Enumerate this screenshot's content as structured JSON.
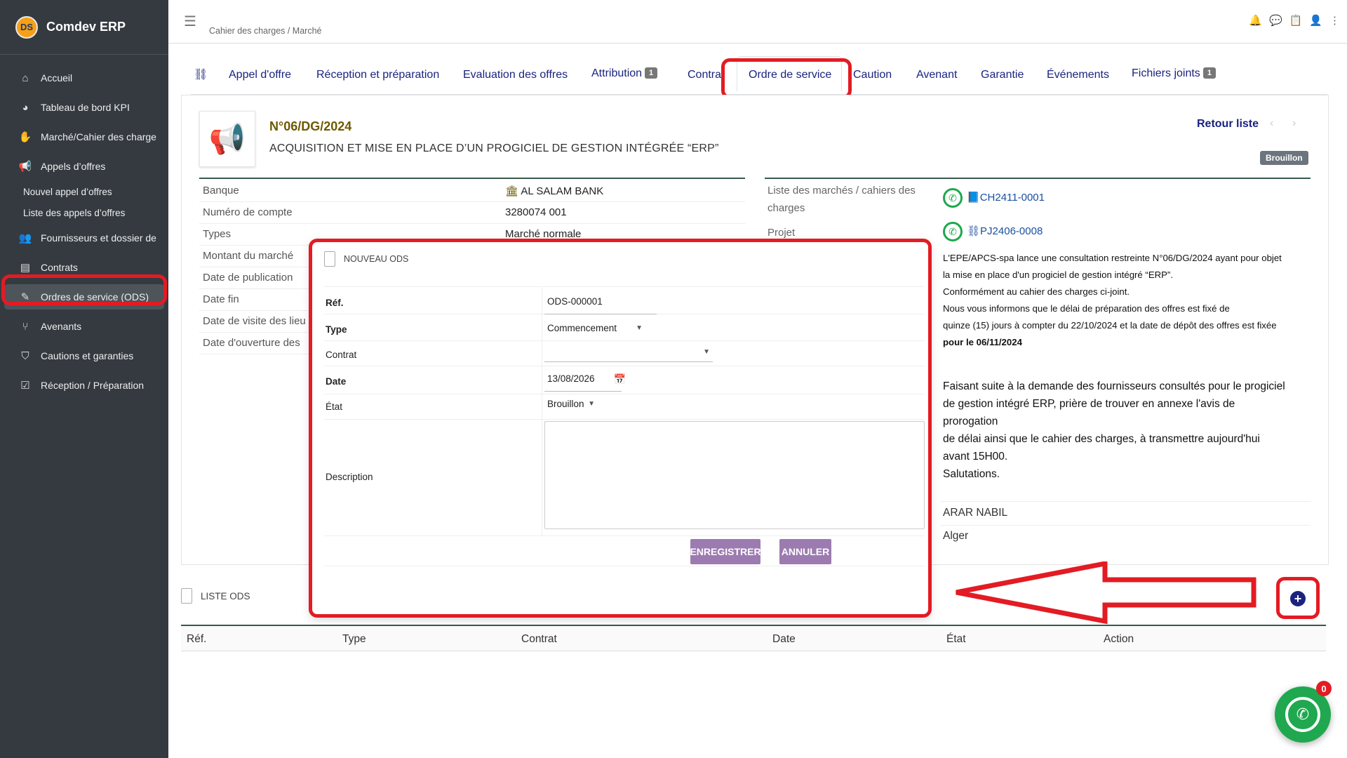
{
  "app": {
    "name": "Comdev ERP",
    "logo_text": "DS"
  },
  "sidebar": {
    "items": [
      {
        "label": "Accueil",
        "icon": "home-icon"
      },
      {
        "label": "Tableau de bord KPI",
        "icon": "chart-pie-icon"
      },
      {
        "label": "Marché/Cahier des charge",
        "icon": "handshake-icon"
      },
      {
        "label": "Appels d’offres",
        "icon": "megaphone-icon"
      },
      {
        "label": "Nouvel appel d’offres"
      },
      {
        "label": "Liste des appels d’offres"
      },
      {
        "label": "Fournisseurs et dossier de",
        "icon": "users-icon"
      },
      {
        "label": "Contrats",
        "icon": "file-icon"
      },
      {
        "label": "Ordres de service (ODS)",
        "icon": "file-signature-icon"
      },
      {
        "label": "Avenants",
        "icon": "branch-icon"
      },
      {
        "label": "Cautions et garanties",
        "icon": "shield-icon"
      },
      {
        "label": "Réception / Préparation",
        "icon": "clipboard-check-icon"
      }
    ]
  },
  "topbar": {
    "breadcrumb": "Cahier des charges / Marché"
  },
  "tabs": [
    {
      "label": "Appel d'offre"
    },
    {
      "label": "Réception et préparation"
    },
    {
      "label": "Evaluation des offres"
    },
    {
      "label": "Attribution",
      "badge": "1"
    },
    {
      "label": "Contrat"
    },
    {
      "label": "Ordre de service"
    },
    {
      "label": "Caution"
    },
    {
      "label": "Avenant"
    },
    {
      "label": "Garantie"
    },
    {
      "label": "Événements"
    },
    {
      "label": "Fichiers joints",
      "badge": "1"
    }
  ],
  "record": {
    "ref": "N°06/DG/2024",
    "subject": "ACQUISITION ET MISE EN PLACE D’UN PROGICIEL DE GESTION INTÉGRÉE “ERP”",
    "back_label": "Retour liste",
    "status": "Brouillon"
  },
  "details_left": [
    {
      "key": "Banque",
      "value": "AL SALAM BANK"
    },
    {
      "key": "Numéro de compte",
      "value": "3280074 001"
    },
    {
      "key": "Types",
      "value": "Marché normale"
    },
    {
      "key": "Montant du marché",
      "value": ""
    },
    {
      "key": "Date de publication",
      "value": ""
    },
    {
      "key": "Date fin",
      "value": ""
    },
    {
      "key": "Date de visite des lieu",
      "value": ""
    },
    {
      "key": "Date d'ouverture des",
      "value": ""
    }
  ],
  "details_right": {
    "marches_label_1": "Liste des marchés / cahiers des",
    "marches_label_2": "charges",
    "marches_value": "CH2411-0001",
    "projet_label": "Projet",
    "projet_value": "PJ2406-0008",
    "desc_lines": [
      "L'EPE/APCS-spa lance une consultation restreinte N°06/DG/2024 ayant pour objet",
      "la mise en place d'un progiciel de gestion intégré “ERP”.",
      "Conformément au cahier des charges ci-joint.",
      "Nous vous informons que le délai de préparation des offres est fixé de",
      "quinze (15) jours à compter du 22/10/2024 et la date de dépôt des offres est fixée",
      "pour le 06/11/2024"
    ],
    "desc2_lines": [
      "Faisant suite à la demande des fournisseurs consultés pour le progiciel",
      "de gestion intégré ERP, prière de trouver en annexe l'avis de",
      "prorogation",
      "de délai ainsi que le cahier des charges, à transmettre aujourd'hui",
      "avant 15H00.",
      "Salutations."
    ],
    "signatory": "ARAR NABIL",
    "city": "Alger"
  },
  "modal": {
    "title": "NOUVEAU ODS",
    "ref_label": "Réf.",
    "ref_value": "ODS-000001",
    "type_label": "Type",
    "type_value": "Commencement",
    "contrat_label": "Contrat",
    "contrat_value": "",
    "date_label": "Date",
    "date_value": "13/08/2026",
    "etat_label": "État",
    "etat_value": "Brouillon",
    "description_label": "Description",
    "save_label": "ENREGISTRER",
    "cancel_label": "ANNULER"
  },
  "list": {
    "title": "LISTE ODS",
    "columns": [
      "Réf.",
      "Type",
      "Contrat",
      "Date",
      "État",
      "Action"
    ]
  },
  "whatsapp": {
    "count": "0"
  },
  "colors": {
    "sidebar": "#343a40",
    "accent": "#1a237e",
    "highlight": "#e31b23",
    "button": "#9c7bb0"
  }
}
